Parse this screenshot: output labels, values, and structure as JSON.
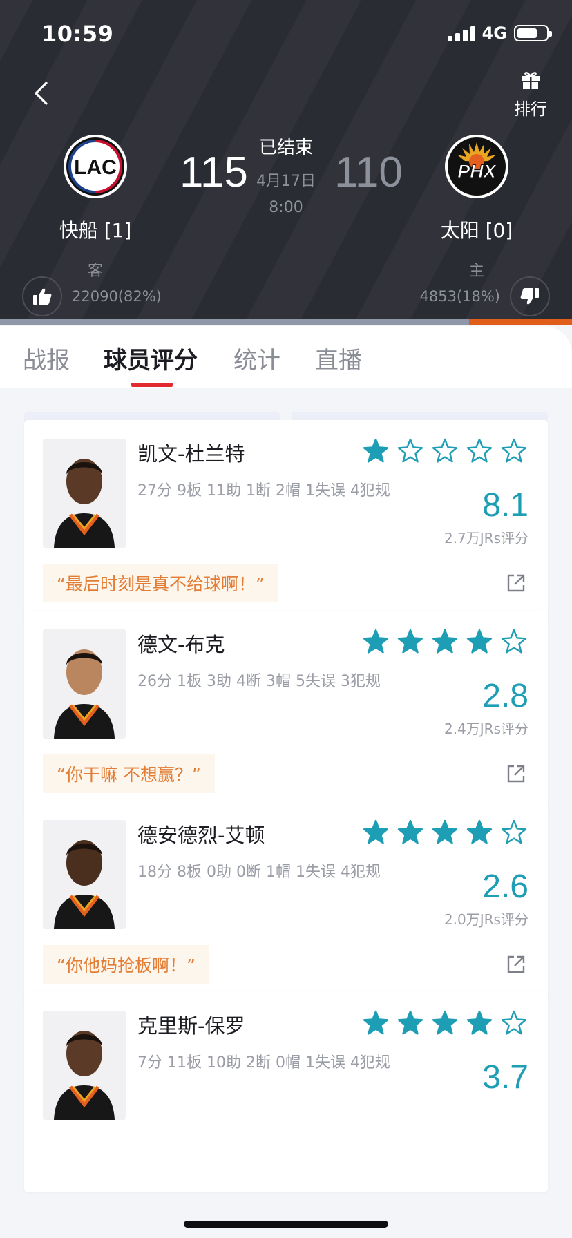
{
  "status_bar": {
    "time": "10:59",
    "network": "4G"
  },
  "header": {
    "rank_label": "排行",
    "game_status": "已结束",
    "game_date": "4月17日",
    "game_time": "8:00",
    "away": {
      "name": "快船 [1]",
      "role": "客",
      "score": "115",
      "votes": "22090(82%)",
      "logo_text": "LAC",
      "color": "#1d428a"
    },
    "home": {
      "name": "太阳 [0]",
      "role": "主",
      "score": "110",
      "votes": "4853(18%)",
      "logo_text": "PHX",
      "color": "#e56020"
    },
    "vote_share_away": 0.82
  },
  "tabs": [
    {
      "label": "战报"
    },
    {
      "label": "球员评分"
    },
    {
      "label": "统计"
    },
    {
      "label": "直播"
    }
  ],
  "active_tab": "球员评分",
  "team_toggle": {
    "away_label": "快船",
    "home_label": "太阳",
    "selected": "太阳"
  },
  "players": [
    {
      "name": "凯文-杜兰特",
      "stats": "27分 9板 11助 1断 2帽 1失误 4犯规",
      "stars": 1,
      "rating": "8.1",
      "rating_count": "2.7万JRs评分",
      "quote": "“最后时刻是真不给球啊！”"
    },
    {
      "name": "德文-布克",
      "stats": "26分 1板 3助 4断 3帽 5失误 3犯规",
      "stars": 4,
      "rating": "2.8",
      "rating_count": "2.4万JRs评分",
      "quote": "“你干嘛 不想赢？”"
    },
    {
      "name": "德安德烈-艾顿",
      "stats": "18分 8板 0助 0断 1帽 1失误 4犯规",
      "stars": 4,
      "rating": "2.6",
      "rating_count": "2.0万JRs评分",
      "quote": "“你他妈抢板啊！”"
    },
    {
      "name": "克里斯-保罗",
      "stats": "7分 11板 10助 2断 0帽 1失误 4犯规",
      "stars": 4,
      "rating": "3.7",
      "rating_count": "",
      "quote": ""
    }
  ],
  "colors": {
    "accent_rating": "#1d9eb4",
    "tab_indicator": "#e02a30",
    "quote_text": "#e37d35",
    "header_bg": "#2a2c33"
  }
}
